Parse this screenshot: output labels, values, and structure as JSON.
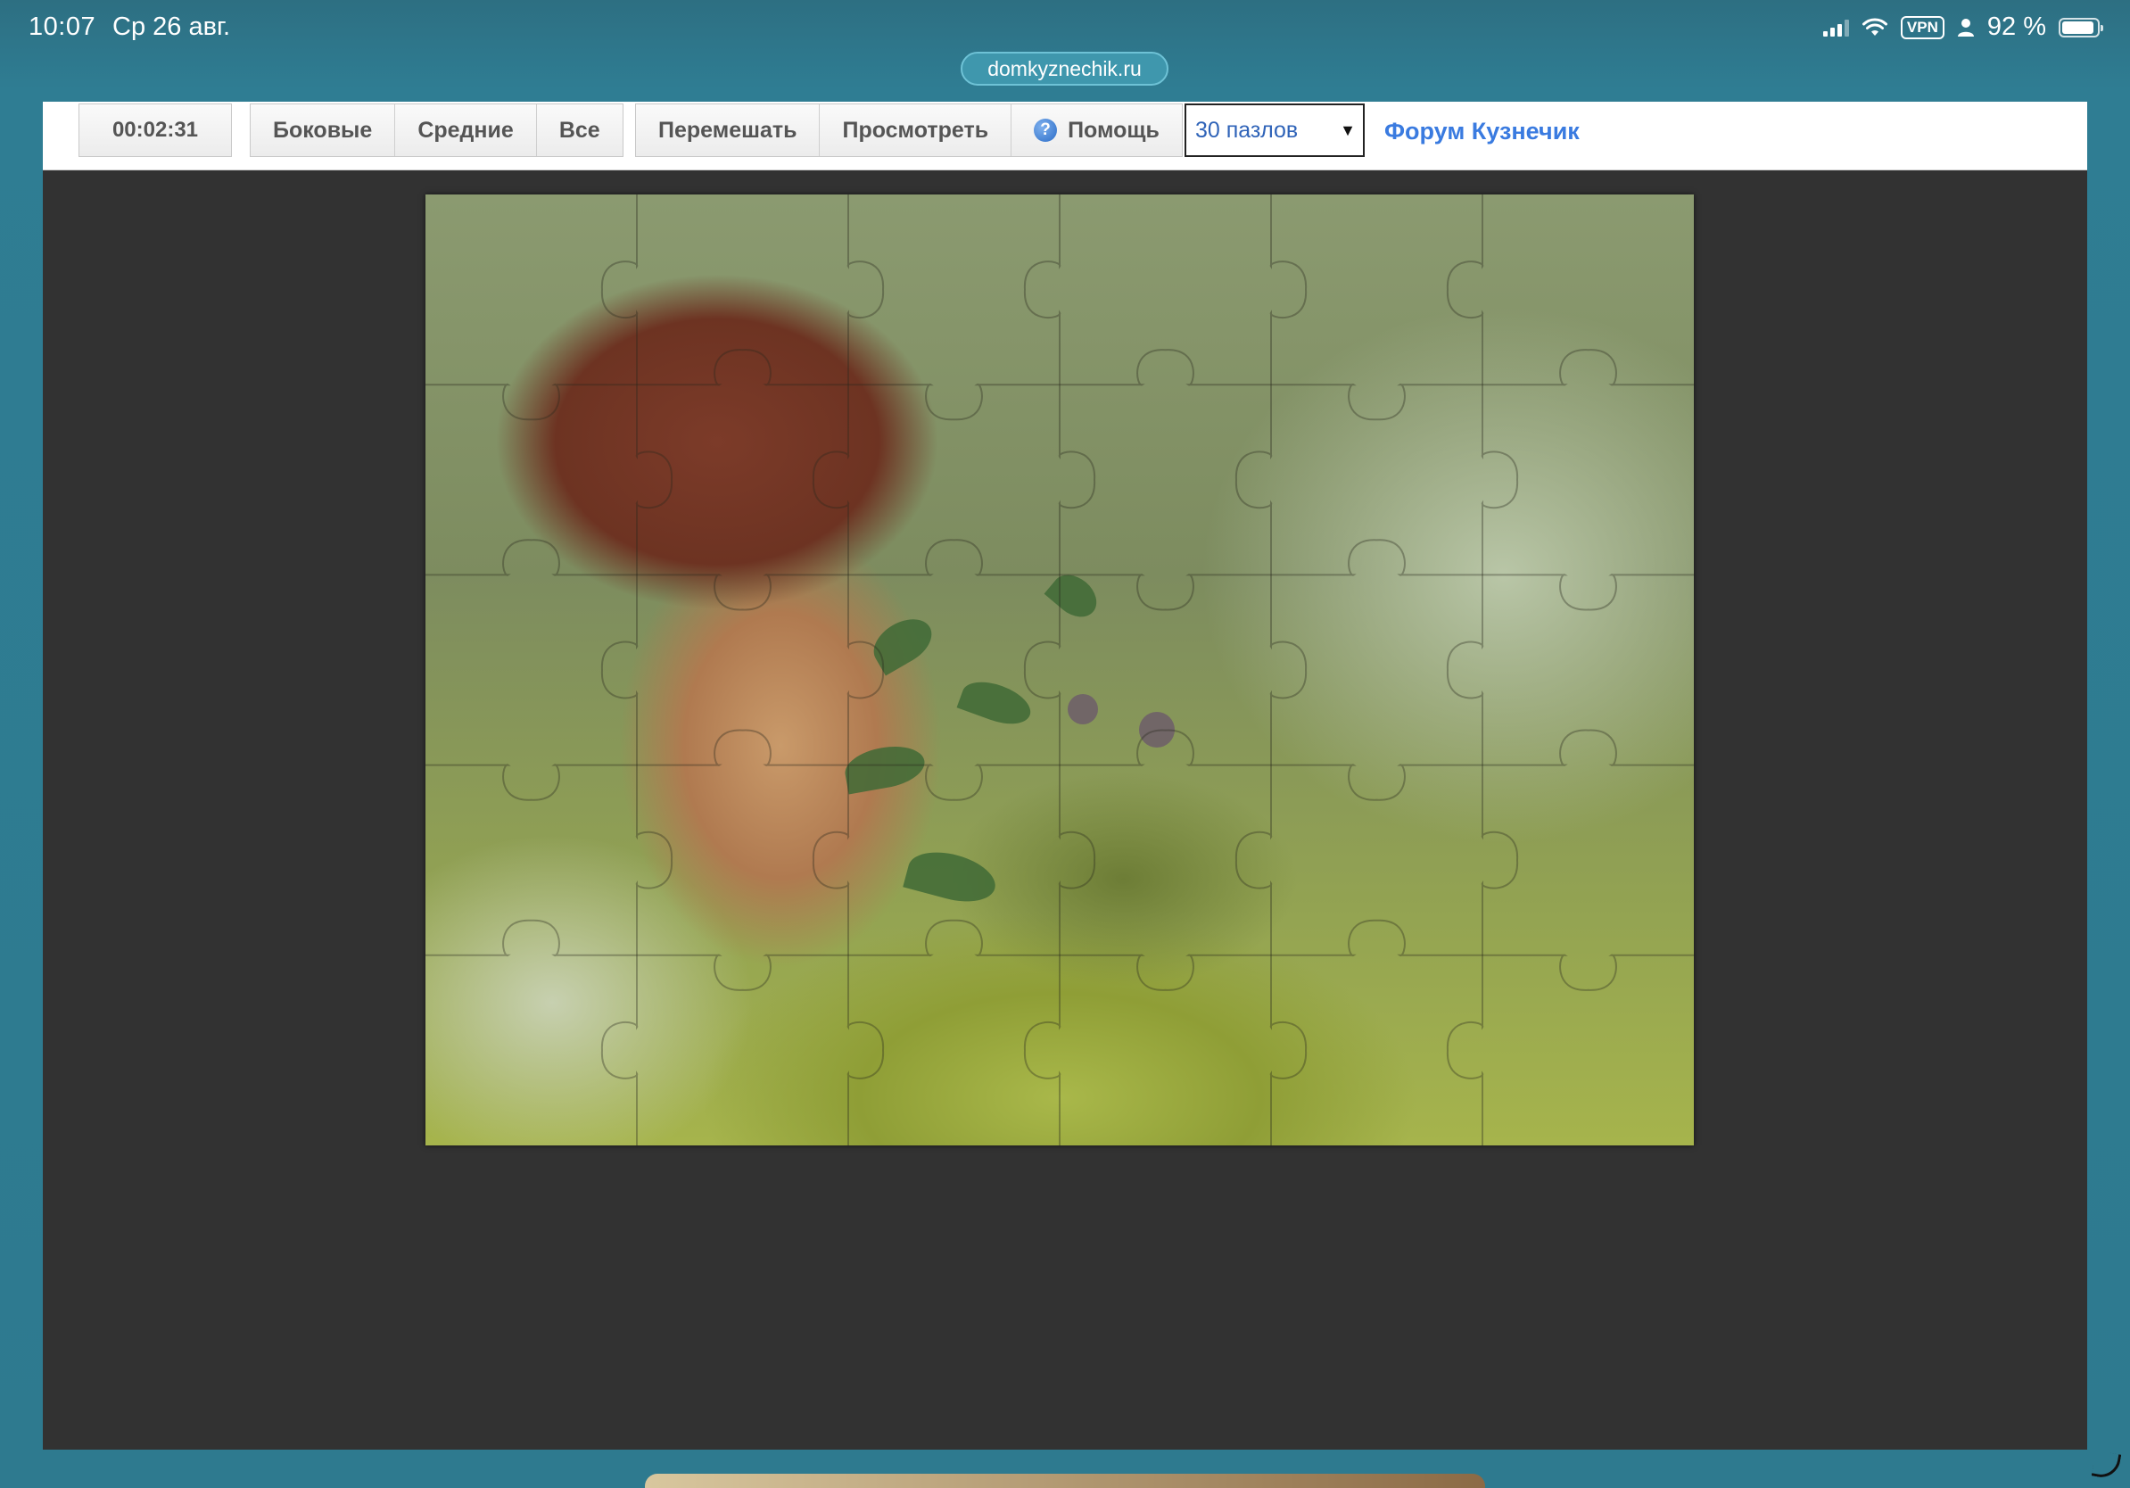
{
  "status_bar": {
    "time": "10:07",
    "date": "Ср 26 авг.",
    "vpn": "VPN",
    "battery_text": "92 %",
    "battery_level": 0.92
  },
  "address": {
    "url": "domkyznechik.ru"
  },
  "toolbar": {
    "timer": "00:02:31",
    "filter_buttons": [
      "Боковые",
      "Средние",
      "Все"
    ],
    "action_buttons": {
      "shuffle": "Перемешать",
      "preview": "Просмотреть",
      "help": "Помощь"
    },
    "help_icon_glyph": "?",
    "pieces_select": {
      "value": "30 пазлов",
      "arrow": "▼"
    },
    "forum_link": "Форум Кузнечик"
  },
  "puzzle": {
    "columns": 6,
    "rows": 5,
    "pieces": 30,
    "image_subject": "mushroom-in-moss"
  },
  "colors": {
    "background_teal": "#2f7a8e",
    "board_dark": "#323232",
    "link_blue": "#3a7be0"
  }
}
